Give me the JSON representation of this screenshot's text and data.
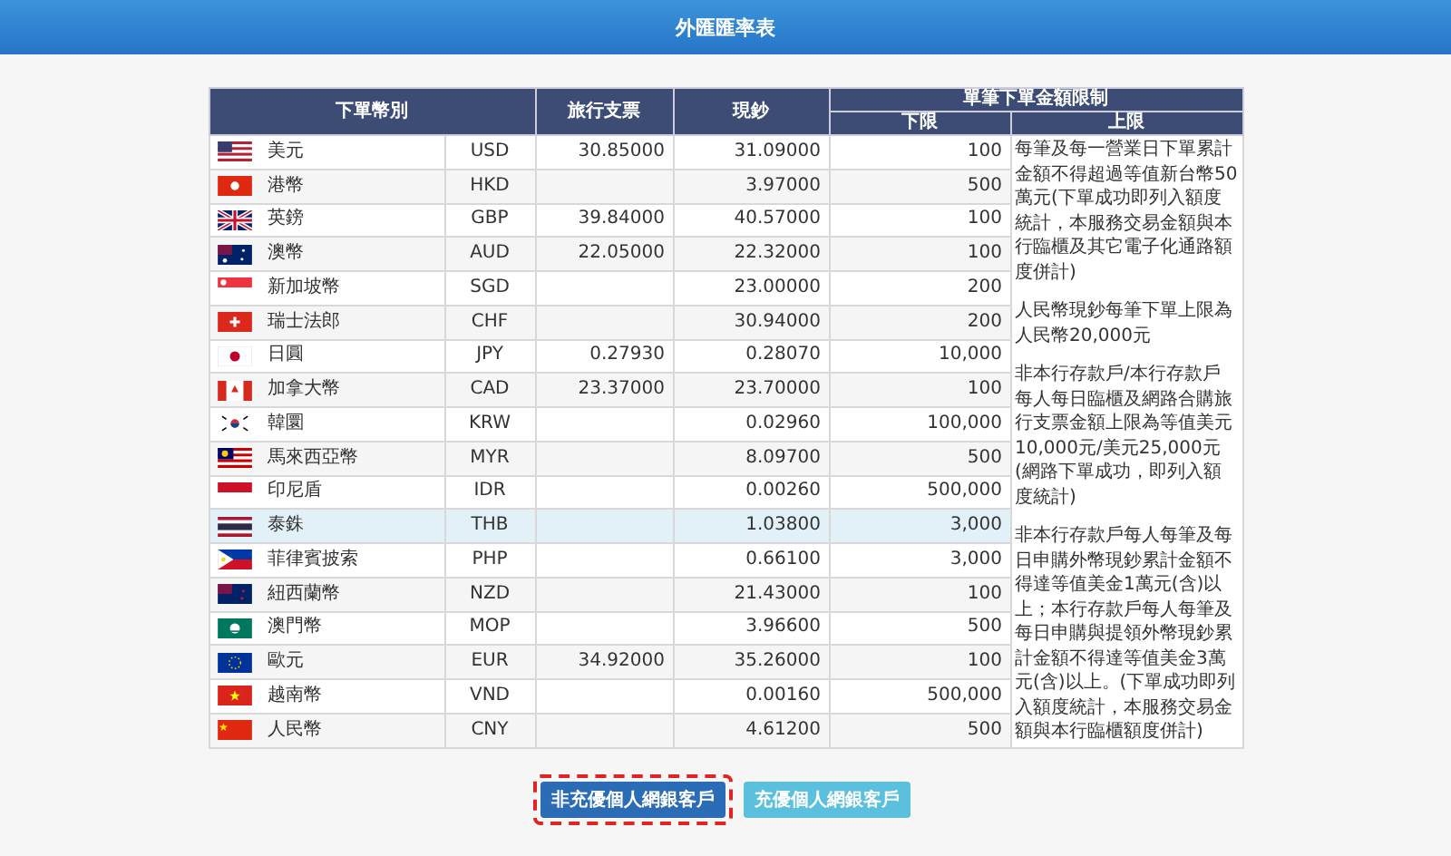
{
  "title": "外匯匯率表",
  "table": {
    "columns": {
      "currency": "下單幣別",
      "travelers_cheque": "旅行支票",
      "cash": "現鈔",
      "limit": "單筆下單金額限制",
      "lower": "下限",
      "upper": "上限"
    },
    "rows": [
      {
        "name": "美元",
        "code": "USD",
        "cheque": "30.85000",
        "cash": "31.09000",
        "lower": "100",
        "highlighted": false
      },
      {
        "name": "港幣",
        "code": "HKD",
        "cash": "3.97000",
        "lower": "500",
        "highlighted": false
      },
      {
        "name": "英鎊",
        "code": "GBP",
        "cheque": "39.84000",
        "cash": "40.57000",
        "lower": "100",
        "highlighted": false
      },
      {
        "name": "澳幣",
        "code": "AUD",
        "cheque": "22.05000",
        "cash": "22.32000",
        "lower": "100",
        "highlighted": false
      },
      {
        "name": "新加坡幣",
        "code": "SGD",
        "cash": "23.00000",
        "lower": "200",
        "highlighted": false
      },
      {
        "name": "瑞士法郎",
        "code": "CHF",
        "cash": "30.94000",
        "lower": "200",
        "highlighted": false
      },
      {
        "name": "日圓",
        "code": "JPY",
        "cheque": "0.27930",
        "cash": "0.28070",
        "lower": "10,000",
        "highlighted": false
      },
      {
        "name": "加拿大幣",
        "code": "CAD",
        "cheque": "23.37000",
        "cash": "23.70000",
        "lower": "100",
        "highlighted": false
      },
      {
        "name": "韓圜",
        "code": "KRW",
        "cash": "0.02960",
        "lower": "100,000",
        "highlighted": false
      },
      {
        "name": "馬來西亞幣",
        "code": "MYR",
        "cash": "8.09700",
        "lower": "500",
        "highlighted": false
      },
      {
        "name": "印尼盾",
        "code": "IDR",
        "cash": "0.00260",
        "lower": "500,000",
        "highlighted": false
      },
      {
        "name": "泰銖",
        "code": "THB",
        "cash": "1.03800",
        "lower": "3,000",
        "highlighted": true
      },
      {
        "name": "菲律賓披索",
        "code": "PHP",
        "cash": "0.66100",
        "lower": "3,000",
        "highlighted": false
      },
      {
        "name": "紐西蘭幣",
        "code": "NZD",
        "cash": "21.43000",
        "lower": "100",
        "highlighted": false
      },
      {
        "name": "澳門幣",
        "code": "MOP",
        "cash": "3.96600",
        "lower": "500",
        "highlighted": false
      },
      {
        "name": "歐元",
        "code": "EUR",
        "cheque": "34.92000",
        "cash": "35.26000",
        "lower": "100",
        "highlighted": false
      },
      {
        "name": "越南幣",
        "code": "VND",
        "cash": "0.00160",
        "lower": "500,000",
        "highlighted": false
      },
      {
        "name": "人民幣",
        "code": "CNY",
        "cash": "4.61200",
        "lower": "500",
        "highlighted": false
      }
    ],
    "upper_notes": [
      "每筆及每一營業日下單累計金額不得超過等值新台幣50萬元(下單成功即列入額度統計，本服務交易金額與本行臨櫃及其它電子化通路額度併計)",
      "人民幣現鈔每筆下單上限為人民幣20,000元",
      "非本行存款戶/本行存款戶每人每日臨櫃及網路合購旅行支票金額上限為等值美元10,000元/美元25,000元(網路下單成功，即列入額度統計)",
      "非本行存款戶每人每筆及每日申購外幣現鈔累計金額不得達等值美金1萬元(含)以上；本行存款戶每人每筆及每日申購與提領外幣現鈔累計金額不得達等值美金3萬元(含)以上。(下單成功即列入額度統計，本服務交易金額與本行臨櫃額度併計)"
    ]
  },
  "buttons": [
    {
      "label": "非充優個人網銀客戶",
      "selected": true,
      "outlined": true
    },
    {
      "label": "充優個人網銀客戶",
      "selected": false,
      "outlined": false
    }
  ]
}
